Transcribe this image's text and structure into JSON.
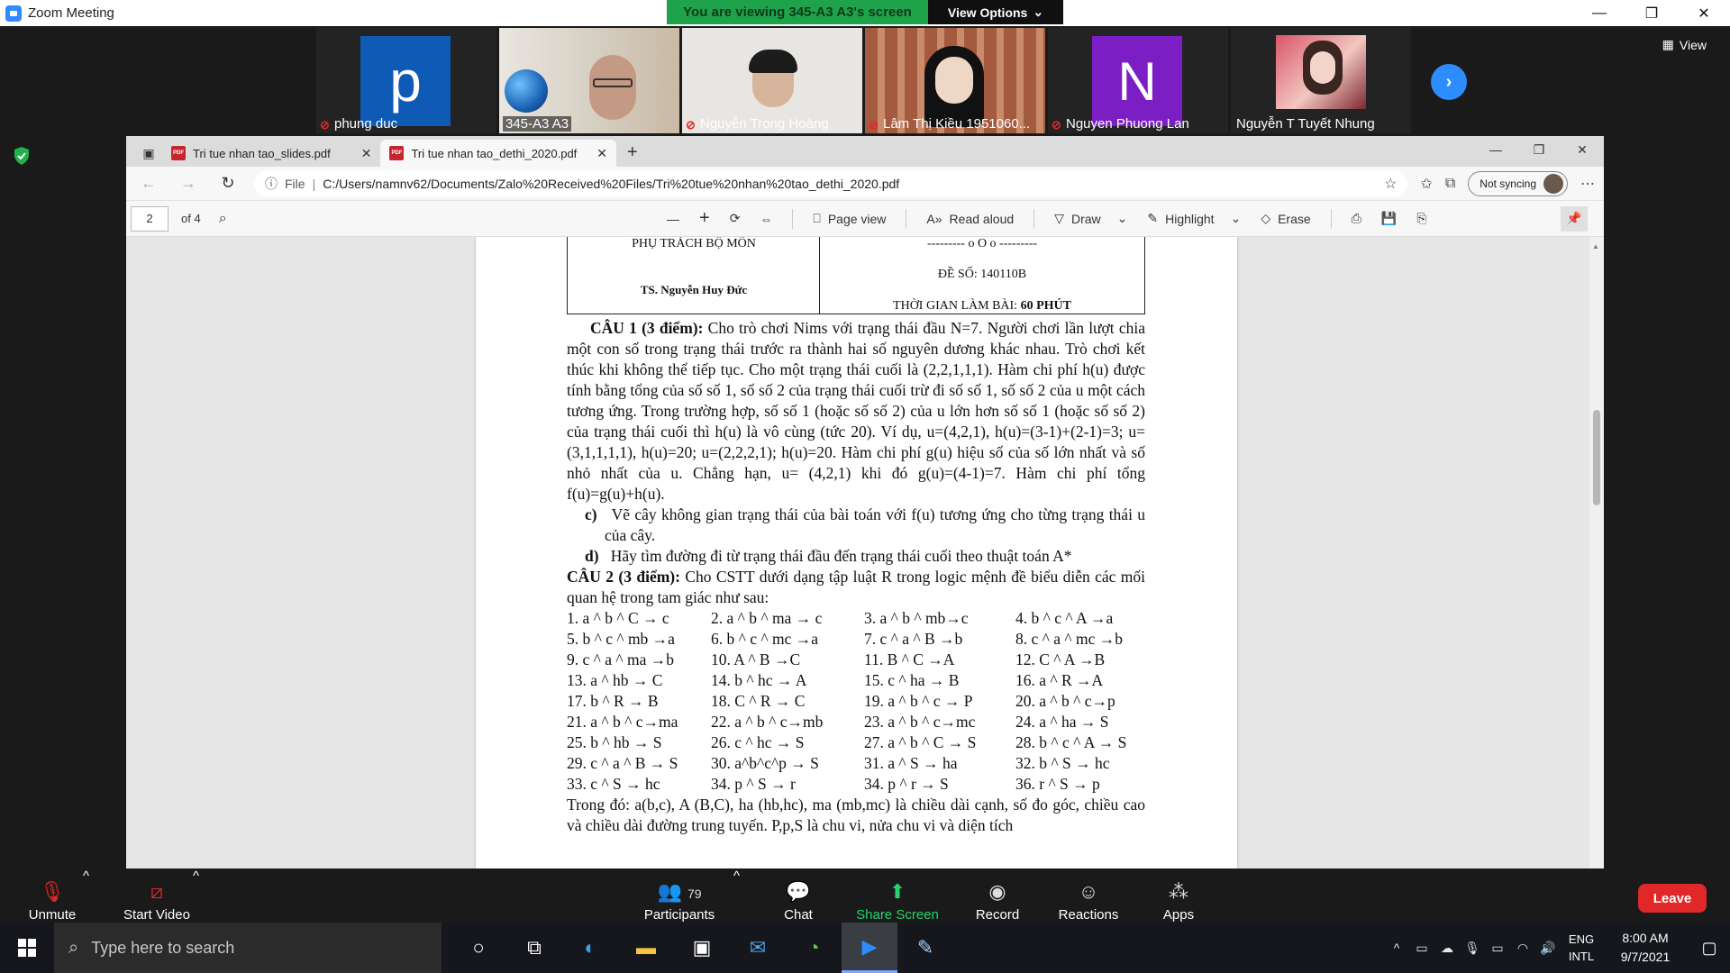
{
  "zoom": {
    "window_title": "Zoom Meeting",
    "viewing_banner": "You are viewing 345-A3 A3's screen",
    "view_options": "View Options",
    "view_label": "View",
    "participants": [
      {
        "name": "phung duc",
        "avatar_letter": "p",
        "avatar_color": "#0e5ab5",
        "muted": true
      },
      {
        "name": "345-A3 A3",
        "muted": false,
        "video": true
      },
      {
        "name": "Nguyễn Trọng Hoàng",
        "muted": true,
        "video": true
      },
      {
        "name": "Lâm Thị Kiều 1951060...",
        "muted": true,
        "video": true
      },
      {
        "name": "Nguyen Phuong Lan",
        "avatar_letter": "N",
        "avatar_color": "#7b1fc4",
        "muted": true
      },
      {
        "name": "Nguyễn T Tuyết Nhung",
        "muted": false,
        "video": true
      }
    ],
    "controls": {
      "unmute": "Unmute",
      "start_video": "Start Video",
      "participants": "Participants",
      "participants_count": "79",
      "chat": "Chat",
      "share_screen": "Share Screen",
      "record": "Record",
      "reactions": "Reactions",
      "apps": "Apps",
      "leave": "Leave"
    }
  },
  "edge": {
    "tabs": [
      {
        "title": "Tri tue nhan tao_slides.pdf",
        "active": false
      },
      {
        "title": "Tri tue nhan tao_dethi_2020.pdf",
        "active": true
      }
    ],
    "address": {
      "prefix": "File",
      "url": "C:/Users/namnv62/Documents/Zalo%20Received%20Files/Tri%20tue%20nhan%20tao_dethi_2020.pdf"
    },
    "sync_label": "Not syncing",
    "pdf_toolbar": {
      "page": "2",
      "of": "of 4",
      "page_view": "Page view",
      "read_aloud": "Read aloud",
      "draw": "Draw",
      "highlight": "Highlight",
      "erase": "Erase"
    }
  },
  "document": {
    "header_left_1": "PHỤ TRÁCH BỘ MÔN",
    "header_left_2": "TS. Nguyễn Huy Đức",
    "header_right_1": "--------- o O o ---------",
    "header_right_2": "ĐỀ SỐ: 140110B",
    "header_right_3_prefix": "THỜI GIAN LÀM BÀI: ",
    "header_right_3_bold": "60 PHÚT",
    "q1_label": "CÂU 1 (3 điểm):",
    "q1_text": " Cho trò chơi Nims với trạng thái đầu N=7. Người chơi lần lượt chia một con số trong trạng thái trước ra thành hai số nguyên dương khác nhau. Trò chơi kết thúc khi không thể tiếp tục. Cho một trạng thái cuối là (2,2,1,1,1). Hàm chi phí h(u) được tính bằng tổng của số số 1, số số 2 của trạng thái cuối trừ đi số số 1, số số 2 của u một cách tương ứng. Trong trường hợp, số số 1 (hoặc số số 2) của u lớn hơn số số 1 (hoặc số số 2) của trạng thái cuối thì h(u) là vô cùng (tức 20). Ví dụ, u=(4,2,1), h(u)=(3-1)+(2-1)=3; u=(3,1,1,1,1), h(u)=20; u=(2,2,2,1); h(u)=20. Hàm chi phí g(u) hiệu số của số lớn nhất và số nhỏ nhất của u. Chẳng hạn, u= (4,2,1) khi đó g(u)=(4-1)=7. Hàm chi phí tổng f(u)=g(u)+h(u).",
    "q1_c_label": "c)",
    "q1_c_text": "Vẽ cây không gian trạng thái của bài toán với f(u) tương ứng cho từng trạng thái u của cây.",
    "q1_d_label": "d)",
    "q1_d_text": "Hãy tìm đường đi từ trạng thái đầu đến trạng thái cuối theo thuật toán A*",
    "q2_label": "CÂU 2 (3 điểm):",
    "q2_text": " Cho CSTT dưới dạng tập luật R trong logic mệnh đề biểu diễn các mối quan hệ trong tam giác như sau:",
    "rules": [
      [
        "1. a ^ b ^ C → c",
        "2. a ^ b ^ ma → c",
        "3. a ^ b ^ mb→c",
        "4. b ^ c ^ A →a"
      ],
      [
        "5. b ^ c ^ mb →a",
        "6. b ^ c ^ mc →a",
        "7. c ^ a ^ B →b",
        "8. c ^ a ^ mc →b"
      ],
      [
        "9. c ^ a ^ ma →b",
        "10. A ^ B →C",
        "11. B ^ C →A",
        "12. C ^ A →B"
      ],
      [
        "13. a ^ hb → C",
        "14. b ^ hc → A",
        "15. c ^ ha → B",
        "16. a ^ R →A"
      ],
      [
        "17. b ^ R → B",
        "18. C ^ R → C",
        "19. a ^ b ^ c → P",
        "20. a ^ b ^ c→p"
      ],
      [
        "21. a ^ b ^ c→ma",
        "22. a ^ b ^ c→mb",
        "23. a ^ b ^ c→mc",
        "24. a ^ ha → S"
      ],
      [
        "25. b ^ hb → S",
        "26. c ^ hc → S",
        "27. a ^ b ^ C → S",
        "28. b ^ c ^ A → S"
      ],
      [
        "29. c ^ a ^ B → S",
        "30. a^b^c^p → S",
        "31. a ^ S → ha",
        "32. b ^ S → hc"
      ],
      [
        "33. c ^ S → hc",
        "34. p ^ S → r",
        "34. p ^ r → S",
        "36. r ^ S → p"
      ]
    ],
    "trong_do": "Trong đó: a(b,c), A (B,C), ha (hb,hc), ma (mb,mc) là chiều dài cạnh, số đo góc, chiều cao và chiều dài đường trung tuyến. P,p,S là chu vi, nửa chu vi và diện tích"
  },
  "taskbar": {
    "search_placeholder": "Type here to search",
    "lang_1": "ENG",
    "lang_2": "INTL",
    "time": "8:00 AM",
    "date": "9/7/2021"
  }
}
